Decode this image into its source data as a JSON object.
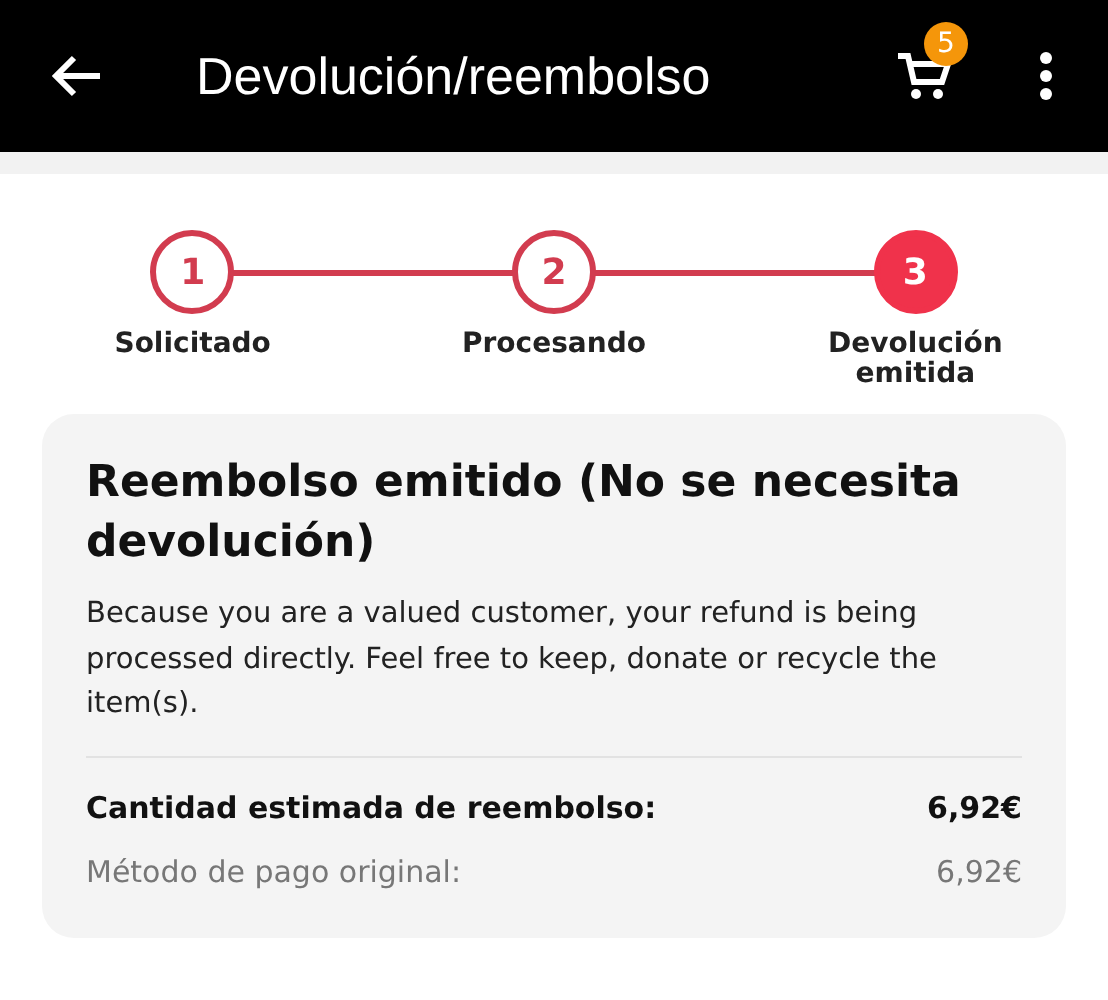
{
  "app_bar": {
    "title": "Devolución/reembolso",
    "cart_count": "5"
  },
  "steps": [
    {
      "number": "1",
      "label": "Solicitado",
      "selected": false
    },
    {
      "number": "2",
      "label": "Procesando",
      "selected": false
    },
    {
      "number": "3",
      "label": "Devolución emitida",
      "selected": true
    }
  ],
  "card": {
    "title": "Reembolso emitido (No se necesita devolución)",
    "message": "Because you are a valued customer, your refund is being processed directly. Feel free to keep, donate or recycle the item(s).",
    "rows": [
      {
        "kind": "total",
        "label": "Cantidad estimada de reembolso:",
        "value": "6,92€"
      },
      {
        "kind": "detail",
        "label": "Método de pago original:",
        "value": "6,92€"
      }
    ]
  }
}
